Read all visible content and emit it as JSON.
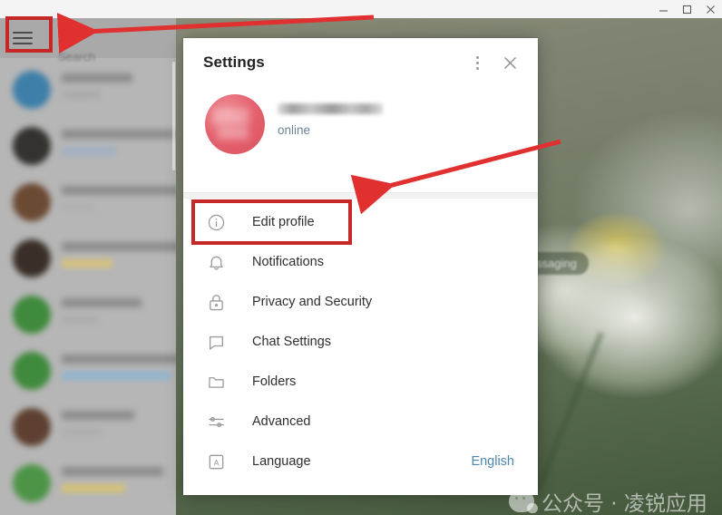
{
  "window": {
    "minimize_label": "Minimize",
    "maximize_label": "Maximize",
    "close_label": "Close"
  },
  "sidebar": {
    "menu_button_name": "hamburger-menu",
    "search_label": "Search",
    "chats": [
      {
        "avatar_color": "#3d7fa8",
        "name_width": 78,
        "msg_width": 42,
        "msg_color": "#aaaaaa"
      },
      {
        "avatar_color": "#33322f",
        "name_width": 126,
        "msg_width": 60,
        "msg_color": "#9fb0c2"
      },
      {
        "avatar_color": "#6b4a33",
        "name_width": 152,
        "msg_width": 36,
        "msg_color": "#b0b0b0"
      },
      {
        "avatar_color": "#3a2f28",
        "name_width": 150,
        "msg_width": 56,
        "msg_color": "#d8c27a"
      },
      {
        "avatar_color": "#3f8a3c",
        "name_width": 88,
        "msg_width": 40,
        "msg_color": "#adadad"
      },
      {
        "avatar_color": "#3f8a3c",
        "name_width": 148,
        "msg_width": 120,
        "msg_color": "#8fb4ce"
      },
      {
        "avatar_color": "#5d4030",
        "name_width": 80,
        "msg_width": 44,
        "msg_color": "#aeaeae"
      },
      {
        "avatar_color": "#4d9447",
        "name_width": 112,
        "msg_width": 70,
        "msg_color": "#d7c274"
      }
    ]
  },
  "main": {
    "chip_label": "Messaging"
  },
  "dialog": {
    "title": "Settings",
    "more_label": "More options",
    "close_label": "Close",
    "profile": {
      "status": "online"
    },
    "menu": [
      {
        "id": "edit-profile",
        "icon": "info-icon",
        "label": "Edit profile",
        "value": ""
      },
      {
        "id": "notifications",
        "icon": "bell-icon",
        "label": "Notifications",
        "value": ""
      },
      {
        "id": "privacy-security",
        "icon": "lock-icon",
        "label": "Privacy and Security",
        "value": ""
      },
      {
        "id": "chat-settings",
        "icon": "chat-icon",
        "label": "Chat Settings",
        "value": ""
      },
      {
        "id": "folders",
        "icon": "folder-icon",
        "label": "Folders",
        "value": ""
      },
      {
        "id": "advanced",
        "icon": "sliders-icon",
        "label": "Advanced",
        "value": ""
      },
      {
        "id": "language",
        "icon": "letter-a-icon",
        "label": "Language",
        "value": "English"
      }
    ]
  },
  "annotations": {
    "highlight_color": "#c62828",
    "arrow_color": "#e03030",
    "boxes": [
      "hamburger-menu-button",
      "edit-profile-row"
    ],
    "arrows": [
      "arrow-to-hamburger",
      "arrow-to-edit-profile"
    ]
  },
  "watermark": {
    "text": "公众号 · 凌锐应用"
  }
}
